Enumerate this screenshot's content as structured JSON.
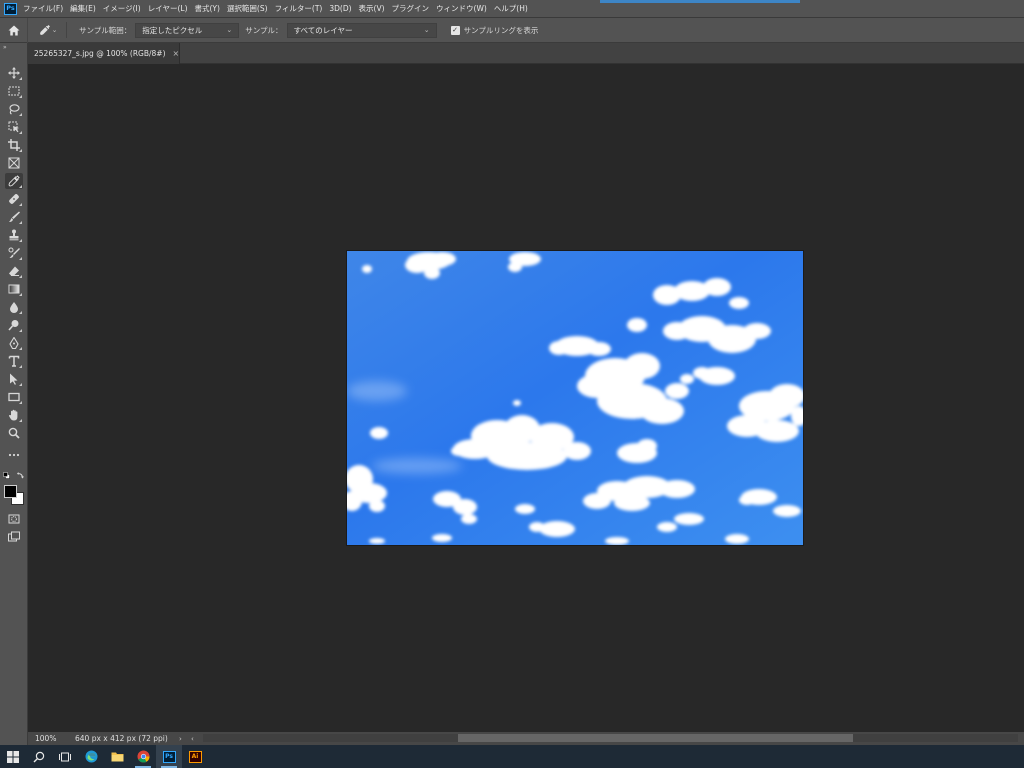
{
  "app": {
    "logo": "Ps"
  },
  "menu": [
    "ファイル(F)",
    "編集(E)",
    "イメージ(I)",
    "レイヤー(L)",
    "書式(Y)",
    "選択範囲(S)",
    "フィルター(T)",
    "3D(D)",
    "表示(V)",
    "プラグイン",
    "ウィンドウ(W)",
    "ヘルプ(H)"
  ],
  "options_bar": {
    "sample_size_label": "サンプル範囲：",
    "sample_size_value": "指定したピクセル",
    "sample_label": "サンプル：",
    "sample_value": "すべてのレイヤー",
    "show_ring_label": "サンプルリングを表示",
    "show_ring_checked": true
  },
  "toolbar": {
    "tools": [
      "move-tool-icon",
      "marquee-tool-icon",
      "lasso-tool-icon",
      "object-select-tool-icon",
      "crop-tool-icon",
      "frame-tool-icon",
      "eyedropper-tool-icon",
      "healing-brush-tool-icon",
      "brush-tool-icon",
      "clone-stamp-tool-icon",
      "history-brush-tool-icon",
      "eraser-tool-icon",
      "gradient-tool-icon",
      "blur-tool-icon",
      "dodge-tool-icon",
      "pen-tool-icon",
      "type-tool-icon",
      "path-select-tool-icon",
      "rectangle-tool-icon",
      "hand-tool-icon",
      "zoom-tool-icon",
      "edit-toolbar-icon"
    ],
    "active_tool": "eyedropper-tool-icon",
    "foreground_color": "#000000",
    "background_color": "#ffffff"
  },
  "document_tab": {
    "title": "25265327_s.jpg @ 100% (RGB/8#)",
    "close": "×"
  },
  "status": {
    "zoom": "100%",
    "doc_size": "640 px x 412 px (72 ppi)"
  },
  "taskbar": {
    "items": [
      "windows-start-icon",
      "search-icon",
      "task-view-icon",
      "edge-browser-icon",
      "file-explorer-icon",
      "chrome-icon",
      "photoshop-icon",
      "illustrator-icon"
    ]
  }
}
